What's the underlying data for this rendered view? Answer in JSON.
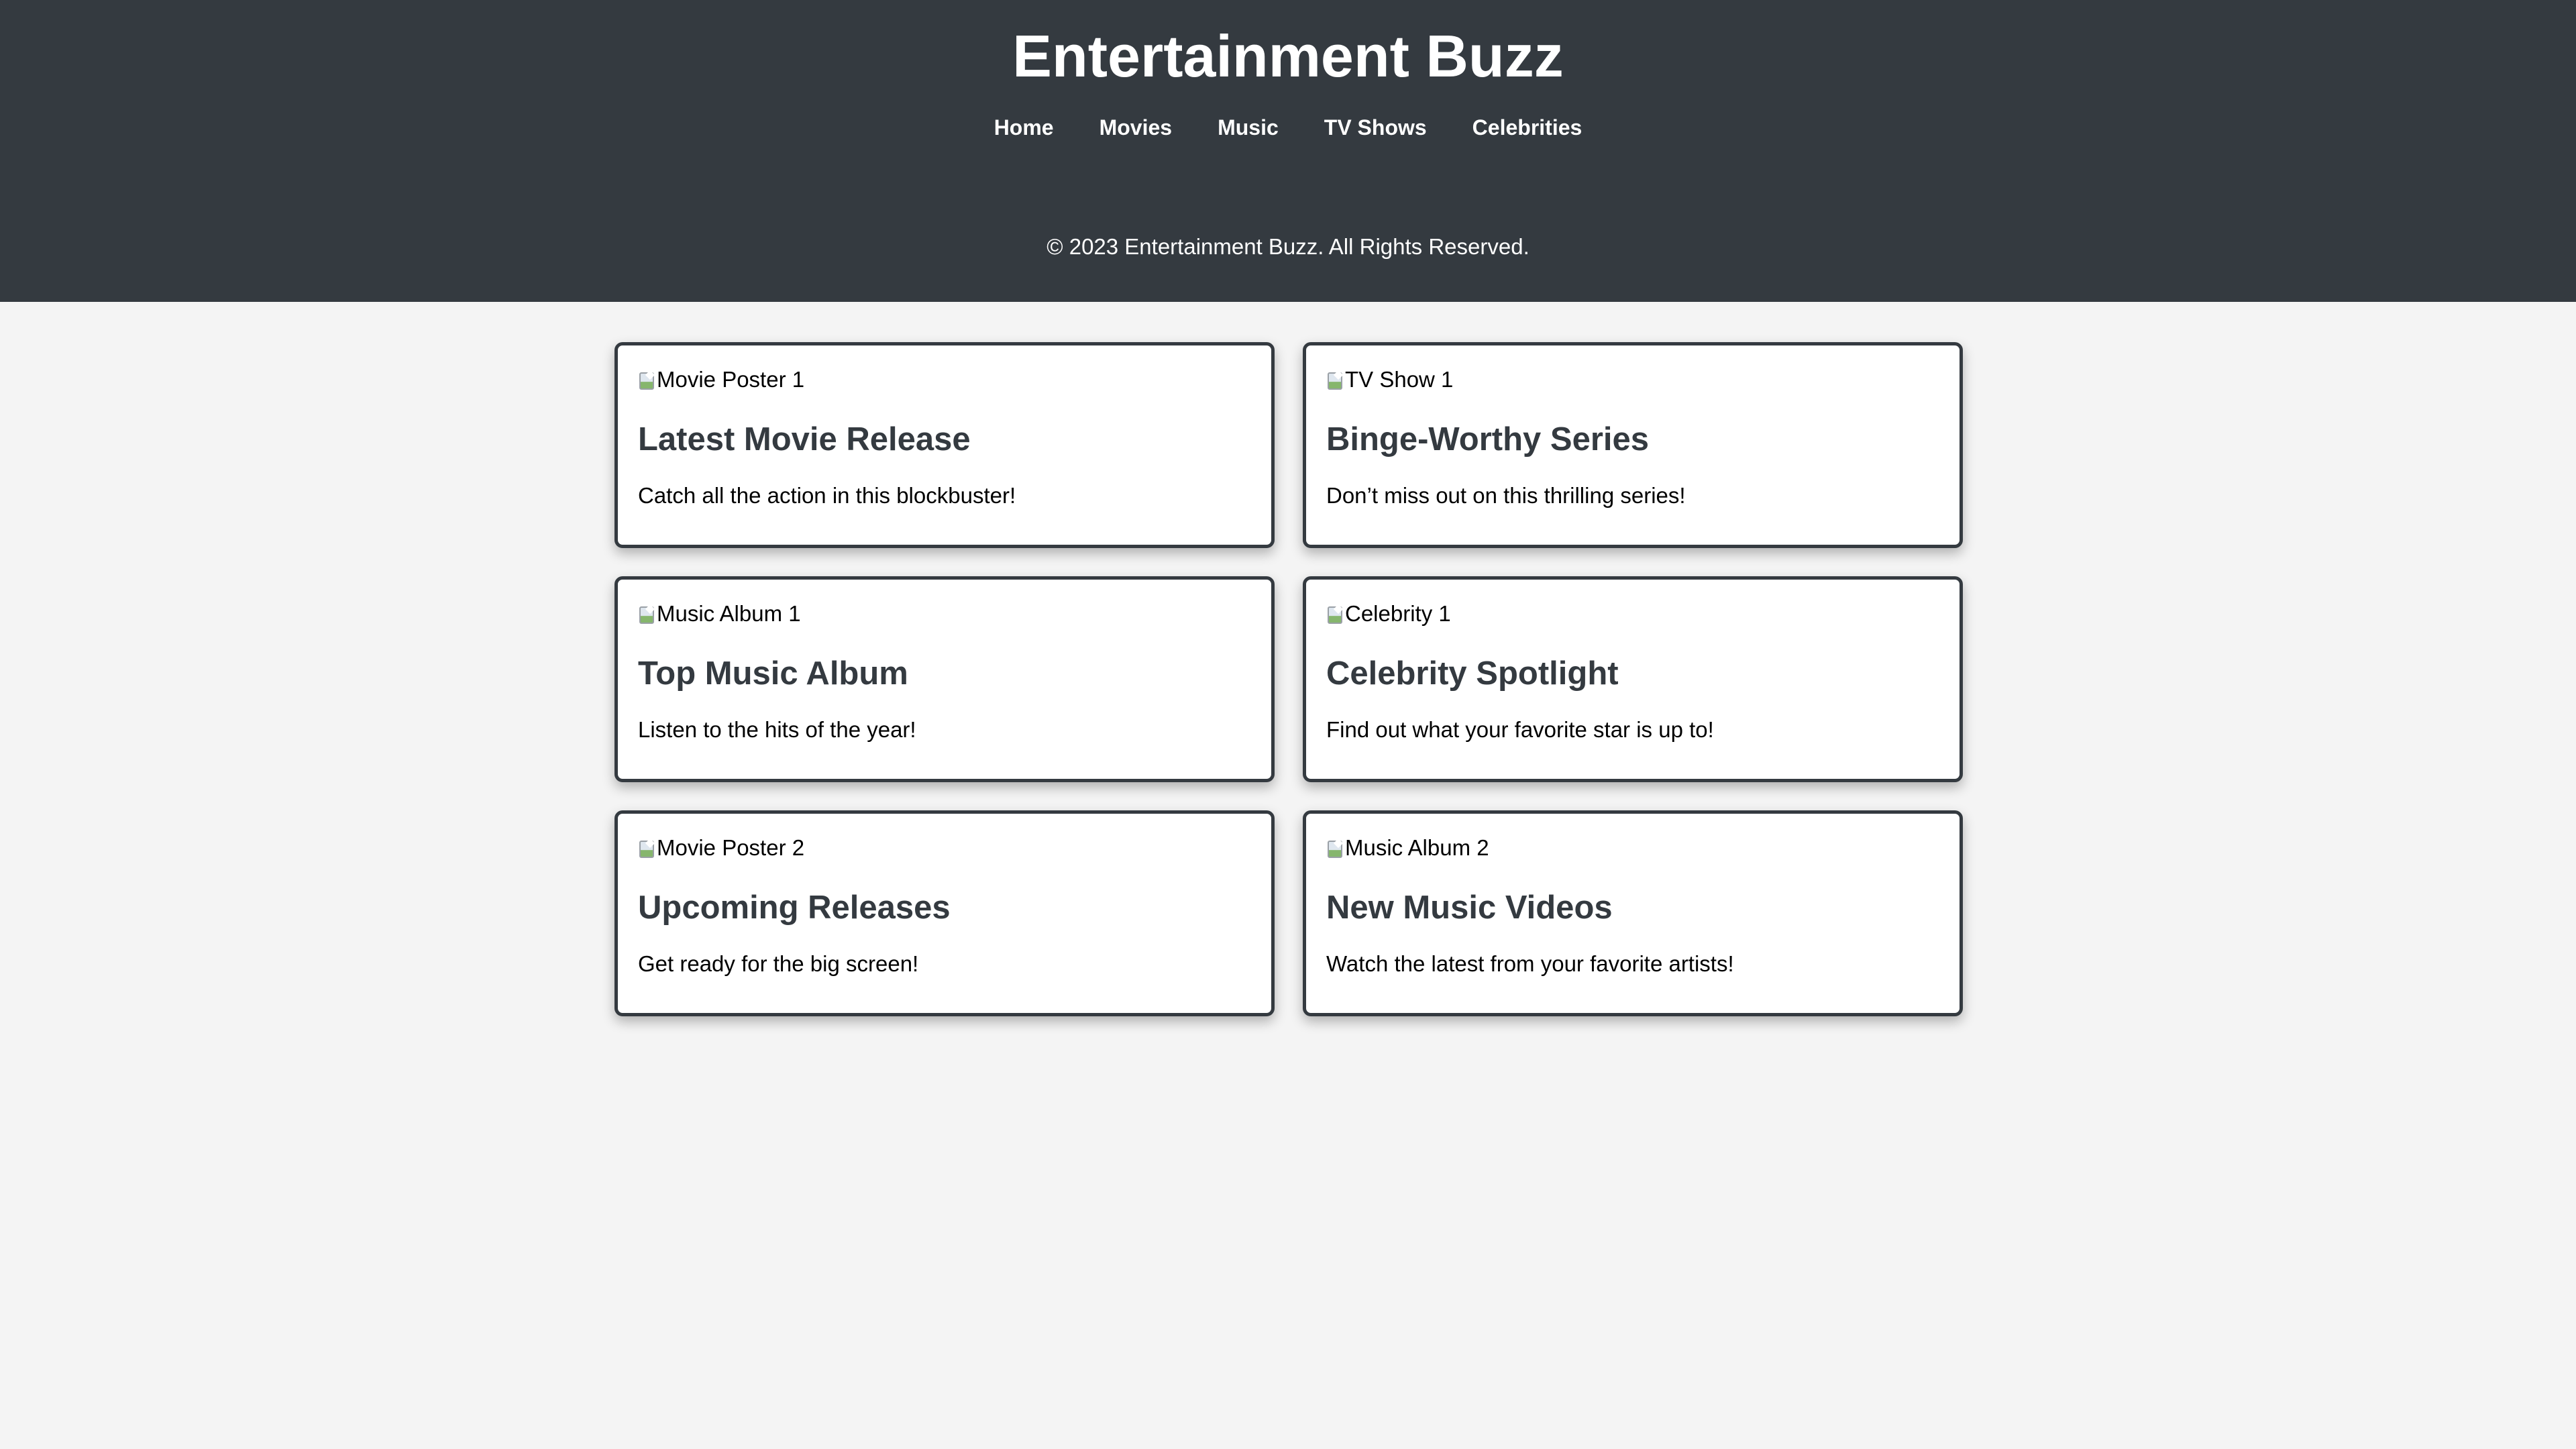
{
  "header": {
    "title": "Entertainment Buzz",
    "nav": [
      {
        "label": "Home"
      },
      {
        "label": "Movies"
      },
      {
        "label": "Music"
      },
      {
        "label": "TV Shows"
      },
      {
        "label": "Celebrities"
      }
    ],
    "copyright": "© 2023 Entertainment Buzz. All Rights Reserved."
  },
  "cards": [
    {
      "image_alt": "Movie Poster 1",
      "title": "Latest Movie Release",
      "description": "Catch all the action in this blockbuster!"
    },
    {
      "image_alt": "TV Show 1",
      "title": "Binge-Worthy Series",
      "description": "Don’t miss out on this thrilling series!"
    },
    {
      "image_alt": "Music Album 1",
      "title": "Top Music Album",
      "description": "Listen to the hits of the year!"
    },
    {
      "image_alt": "Celebrity 1",
      "title": "Celebrity Spotlight",
      "description": "Find out what your favorite star is up to!"
    },
    {
      "image_alt": "Movie Poster 2",
      "title": "Upcoming Releases",
      "description": "Get ready for the big screen!"
    },
    {
      "image_alt": "Music Album 2",
      "title": "New Music Videos",
      "description": "Watch the latest from your favorite artists!"
    }
  ],
  "colors": {
    "header_background": "#343a40",
    "page_background": "#f4f4f4",
    "card_background": "#ffffff",
    "card_border": "#343a40",
    "text": "#000000",
    "heading_text": "#343a40"
  },
  "icons": {
    "broken_image": "broken-image-icon"
  }
}
